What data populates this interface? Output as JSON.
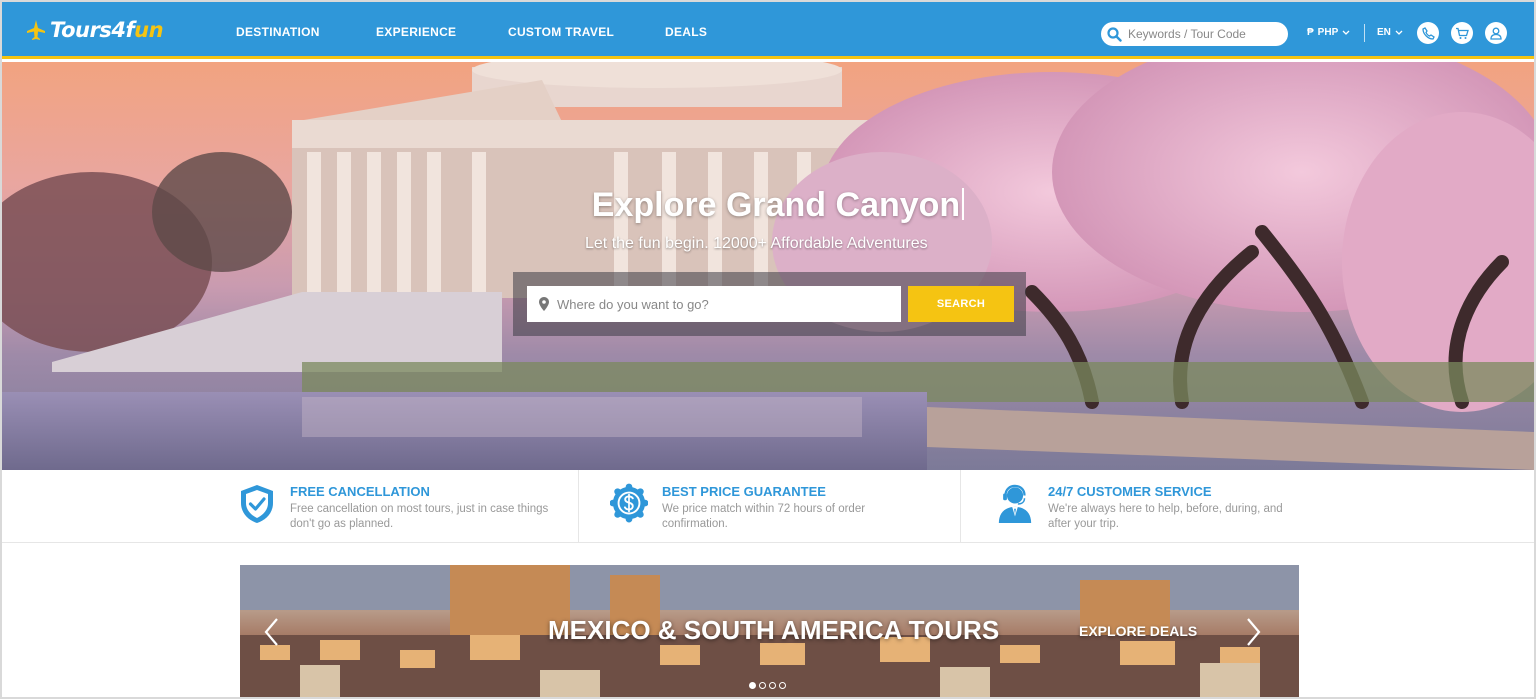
{
  "brand": {
    "logo_text_main": "Tours4f",
    "logo_text_accent": "u",
    "logo_text_end": "n"
  },
  "nav": {
    "items": [
      {
        "label": "DESTINATION"
      },
      {
        "label": "EXPERIENCE"
      },
      {
        "label": "CUSTOM TRAVEL"
      },
      {
        "label": "DEALS"
      }
    ]
  },
  "header": {
    "search_placeholder": "Keywords / Tour Code",
    "currency_symbol": "₱",
    "currency": "PHP",
    "language": "EN",
    "icons": [
      "phone-icon",
      "cart-icon",
      "user-icon"
    ]
  },
  "hero": {
    "title": "Explore Grand Canyon",
    "subtitle": "Let the fun begin. 12000+ Affordable Adventures",
    "search_placeholder": "Where do you want to go?",
    "search_button": "SEARCH"
  },
  "features": [
    {
      "icon": "shield-check-icon",
      "title": "FREE CANCELLATION",
      "desc_line1": "Free cancellation on most tours, just in case things",
      "desc_line2": "don't go as planned."
    },
    {
      "icon": "dollar-badge-icon",
      "title": "BEST PRICE GUARANTEE",
      "desc_line1": "We price match within 72 hours of order",
      "desc_line2": "confirmation."
    },
    {
      "icon": "support-agent-icon",
      "title": "24/7 CUSTOMER SERVICE",
      "desc_line1": "We're always here to help, before, during, and",
      "desc_line2": "after your trip."
    }
  ],
  "banner": {
    "title": "MEXICO & SOUTH AMERICA TOURS",
    "cta": "EXPLORE DEALS",
    "slide_count": 4,
    "active_slide": 1
  },
  "colors": {
    "header_blue": "#2f97d9",
    "accent_yellow": "#f5c412",
    "feature_title_blue": "#2f97d9"
  }
}
